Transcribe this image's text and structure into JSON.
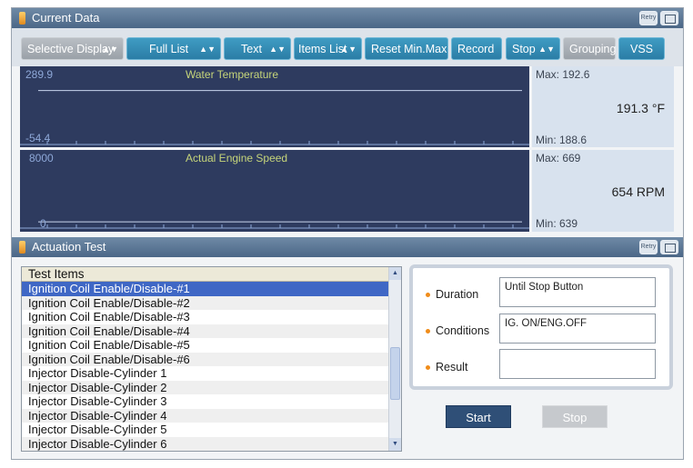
{
  "current_data": {
    "title": "Current Data",
    "retry_label": "Retry",
    "toolbar": [
      {
        "label": "Selective Display",
        "dropdown": true,
        "style": "gray"
      },
      {
        "label": "Full List",
        "dropdown": true,
        "style": "blue"
      },
      {
        "label": "Text",
        "dropdown": true,
        "style": "blue"
      },
      {
        "label": "Items List",
        "dropdown": true,
        "style": "blue"
      },
      {
        "label": "Reset Min.Max",
        "dropdown": false,
        "style": "blue"
      },
      {
        "label": "Record",
        "dropdown": false,
        "style": "blue"
      },
      {
        "label": "Stop",
        "dropdown": true,
        "style": "blue"
      },
      {
        "label": "Grouping",
        "dropdown": false,
        "style": "gray"
      },
      {
        "label": "VSS",
        "dropdown": false,
        "style": "blue"
      }
    ],
    "graphs": [
      {
        "name": "Water Temperature",
        "y_max": "289.9",
        "y_min": "-54.4",
        "max": "Max: 192.6",
        "min": "Min: 188.6",
        "value": "191.3 °F",
        "trace_level": 0.69
      },
      {
        "name": "Actual Engine Speed",
        "y_max": "8000",
        "y_min": "0",
        "max": "Max: 669",
        "min": "Min: 639",
        "value": "654 RPM",
        "trace_level": 0.08
      }
    ]
  },
  "actuation_test": {
    "title": "Actuation Test",
    "retry_label": "Retry",
    "list_header": "Test Items",
    "items": [
      "Ignition Coil Enable/Disable-#1",
      "Ignition Coil Enable/Disable-#2",
      "Ignition Coil Enable/Disable-#3",
      "Ignition Coil Enable/Disable-#4",
      "Ignition Coil Enable/Disable-#5",
      "Ignition Coil Enable/Disable-#6",
      "Injector Disable-Cylinder 1",
      "Injector Disable-Cylinder 2",
      "Injector Disable-Cylinder 3",
      "Injector Disable-Cylinder 4",
      "Injector Disable-Cylinder 5",
      "Injector Disable-Cylinder 6"
    ],
    "selected_index": 0,
    "duration_label": "Duration",
    "duration_value": "Until Stop Button",
    "conditions_label": "Conditions",
    "conditions_value": "IG. ON/ENG.OFF",
    "result_label": "Result",
    "result_value": "",
    "start_label": "Start",
    "stop_label": "Stop"
  }
}
